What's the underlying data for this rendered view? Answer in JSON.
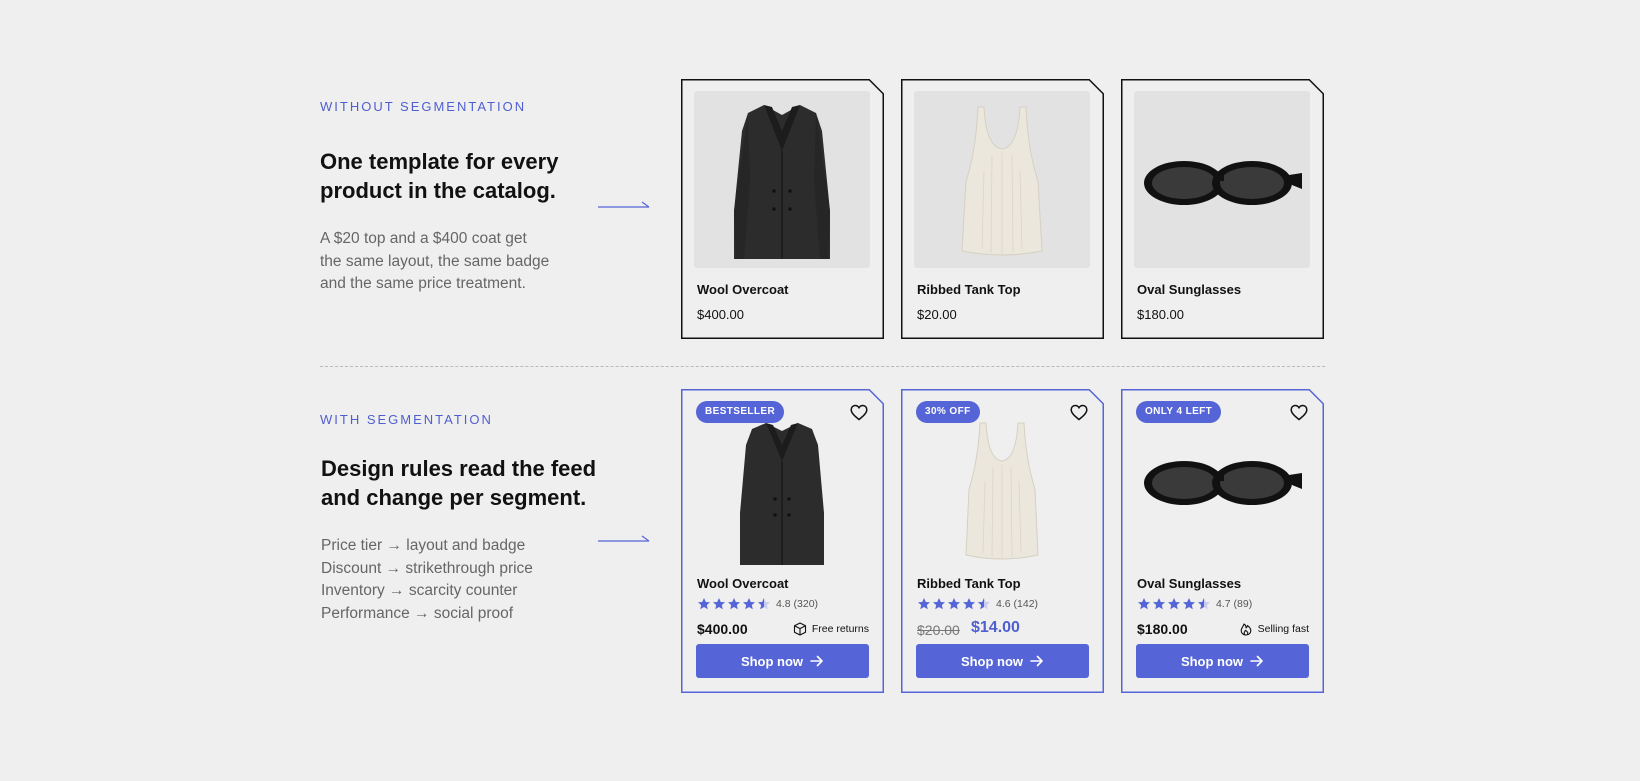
{
  "without": {
    "label": "WITHOUT SEGMENTATION",
    "headline_line1": "One template for every",
    "headline_line2": "product in the catalog.",
    "desc_line1": "A $20 top and a $400 coat get",
    "desc_line2": "the same layout, the same badge",
    "desc_line3": "and the same price treatment.",
    "cards": [
      {
        "name": "Wool Overcoat",
        "price": "$400.00",
        "image": "coat-image"
      },
      {
        "name": "Ribbed Tank Top",
        "price": "$20.00",
        "image": "tank-top-image"
      },
      {
        "name": "Oval Sunglasses",
        "price": "$180.00",
        "image": "sunglasses-image"
      }
    ]
  },
  "with": {
    "label": "WITH SEGMENTATION",
    "headline_line1": "Design rules read the feed",
    "headline_line2": "and change per segment.",
    "rules": [
      "Price tier → layout and badge",
      "Discount → strikethrough price",
      "Inventory → scarcity counter",
      "Performance → social proof"
    ],
    "cards": [
      {
        "badge": "BESTSELLER",
        "name": "Wool Overcoat",
        "stars": 4.5,
        "rating": "4.8 (320)",
        "price": "$400.00",
        "perk": "Free returns",
        "perk_icon": "box-icon",
        "button": "Shop now"
      },
      {
        "badge": "30% OFF",
        "name": "Ribbed Tank Top",
        "stars": 4.5,
        "rating": "4.6 (142)",
        "old_price": "$20.00",
        "new_price": "$14.00",
        "button": "Shop now"
      },
      {
        "badge": "ONLY 4 LEFT",
        "name": "Oval Sunglasses",
        "stars": 4.5,
        "rating": "4.7 (89)",
        "price": "$180.00",
        "perk": "Selling fast",
        "perk_icon": "flame-icon",
        "button": "Shop now"
      }
    ]
  },
  "colors": {
    "accent": "#5565d8",
    "label": "#4f5fd0",
    "background": "#efefef",
    "plain_border": "#111111",
    "seg_border": "#5565d8"
  }
}
